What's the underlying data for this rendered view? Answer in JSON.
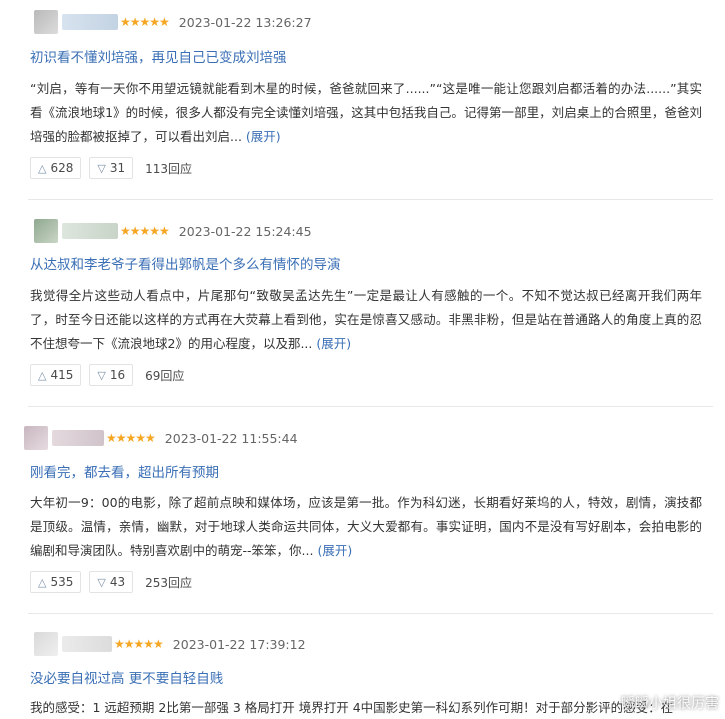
{
  "reviews": [
    {
      "stars": "★★★★★",
      "date": "2023-01-22 13:26:27",
      "title": "初识看不懂刘培强，再见自己已变成刘培强",
      "body": "“刘启，等有一天你不用望远镜就能看到木星的时候，爸爸就回来了......”“这是唯一能让您跟刘启都活着的办法......”其实看《流浪地球1》的时候，很多人都没有完全读懂刘培强，这其中包括我自己。记得第一部里，刘启桌上的合照里，爸爸刘培强的脸都被抠掉了，可以看出刘启...",
      "expand": "(展开)",
      "up": "628",
      "down": "31",
      "replies": "113回应"
    },
    {
      "stars": "★★★★★",
      "date": "2023-01-22 15:24:45",
      "title": "从达叔和李老爷子看得出郭帆是个多么有情怀的导演",
      "body": "我觉得全片这些动人看点中，片尾那句“致敬吴孟达先生”一定是最让人有感触的一个。不知不觉达叔已经离开我们两年了，时至今日还能以这样的方式再在大荧幕上看到他，实在是惊喜又感动。非黑非粉，但是站在普通路人的角度上真的忍不住想夸一下《流浪地球2》的用心程度，以及那...",
      "expand": "(展开)",
      "up": "415",
      "down": "16",
      "replies": "69回应"
    },
    {
      "stars": "★★★★★",
      "date": "2023-01-22 11:55:44",
      "title": "刚看完，都去看，超出所有预期",
      "body": "大年初一9：00的电影，除了超前点映和媒体场，应该是第一批。作为科幻迷，长期看好莱坞的人，特效，剧情，演技都是顶级。温情，亲情，幽默，对于地球人类命运共同体，大义大爱都有。事实证明，国内不是没有写好剧本，会拍电影的编剧和导演团队。特别喜欢剧中的萌宠--笨笨，你...",
      "expand": "(展开)",
      "up": "535",
      "down": "43",
      "replies": "253回应"
    },
    {
      "stars": "★★★★★",
      "date": "2023-01-22 17:39:12",
      "title": "没必要自视过高 更不要自轻自贱",
      "body": "我的感受：1 远超预期 2比第一部强 3 格局打开 境界打开 4中国影史第一科幻系列作可期！对于部分影评的感受：在",
      "expand": "",
      "up": "",
      "down": "",
      "replies": ""
    }
  ],
  "watermark": "瞬瞬小姐很厉害",
  "icons": {
    "up": "triangle-up-icon",
    "down": "triangle-down-icon"
  },
  "colors": {
    "link": "#3a6fb5",
    "star": "#f5a623"
  }
}
